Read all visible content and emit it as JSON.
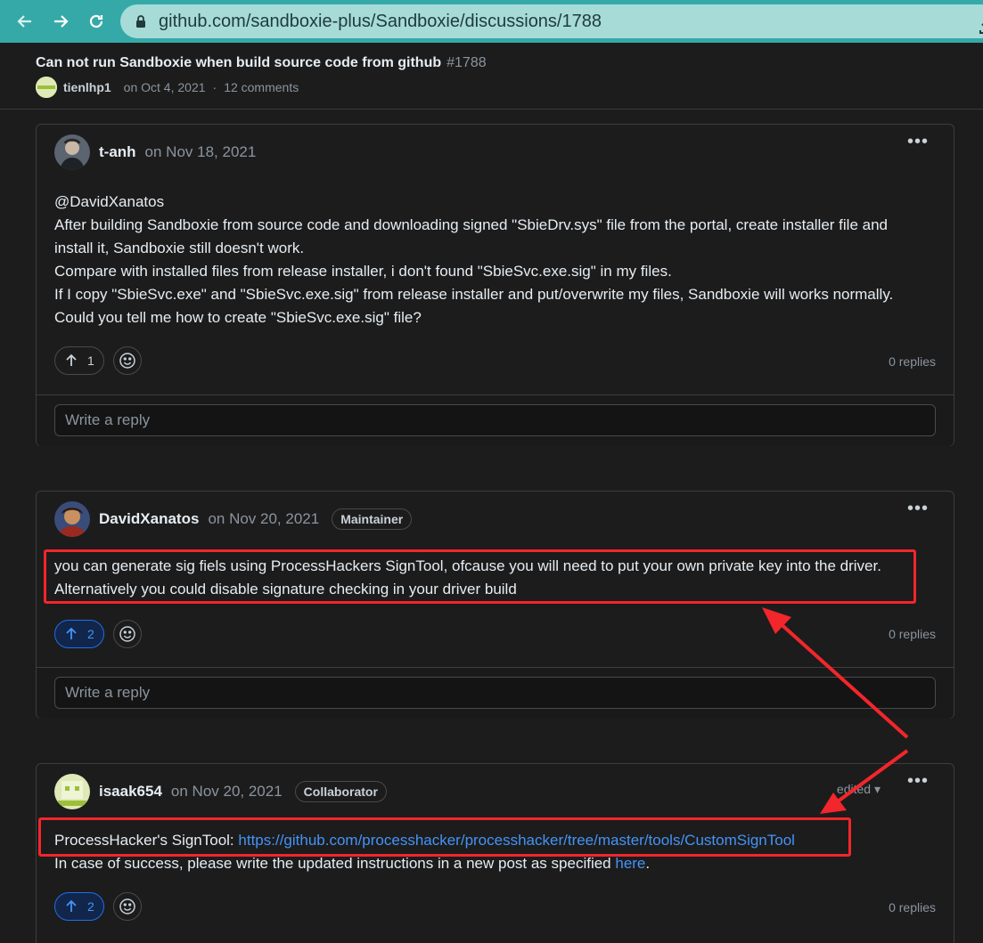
{
  "browser": {
    "url": "github.com/sandboxie-plus/Sandboxie/discussions/1788",
    "icons": [
      "back-arrow-icon",
      "forward-arrow-icon",
      "reload-icon",
      "lock-icon",
      "download-icon"
    ]
  },
  "discussion": {
    "title": "Can not run Sandboxie when build source code from github",
    "number": "#1788",
    "author": "tienlhp1",
    "date": "on Oct 4, 2021",
    "separator": "·",
    "comments": "12 comments"
  },
  "comments": [
    {
      "author": "t-anh",
      "date": "on Nov 18, 2021",
      "lines": [
        "@DavidXanatos",
        "After building Sandboxie from source code and downloading signed \"SbieDrv.sys\" file from the portal, create installer file and",
        "install it, Sandboxie still doesn't work.",
        "Compare with installed files from release installer, i don't found \"SbieSvc.exe.sig\" in my files.",
        "If I copy \"SbieSvc.exe\" and \"SbieSvc.exe.sig\" from release installer and put/overwrite my files, Sandboxie will works normally.",
        "Could you tell me how to create \"SbieSvc.exe.sig\" file?"
      ],
      "upvotes": "1",
      "replies": "0 replies",
      "reply_placeholder": "Write a reply"
    },
    {
      "author": "DavidXanatos",
      "date": "on Nov 20, 2021",
      "badge": "Maintainer",
      "lines": [
        "you can generate sig fiels using ProcessHackers SignTool, ofcause you will need to put your own private key into the driver.",
        "Alternatively you could disable signature checking in your driver build"
      ],
      "upvotes": "2",
      "replies": "0 replies",
      "reply_placeholder": "Write a reply"
    },
    {
      "author": "isaak654",
      "date": "on Nov 20, 2021",
      "badge": "Collaborator",
      "edited": "edited",
      "line1_prefix": "ProcessHacker's SignTool: ",
      "line1_link": "https://github.com/processhacker/processhacker/tree/master/tools/CustomSignTool",
      "line2_prefix": "In case of success, please write the updated instructions in a new post as specified ",
      "line2_link": "here",
      "line2_suffix": ".",
      "upvotes": "2",
      "replies": "0 replies"
    }
  ],
  "colors": {
    "browser_accent": "#35a9a8",
    "annotation_red": "#f3262b",
    "link_blue": "#4493f8",
    "background": "#1c1c1c"
  }
}
